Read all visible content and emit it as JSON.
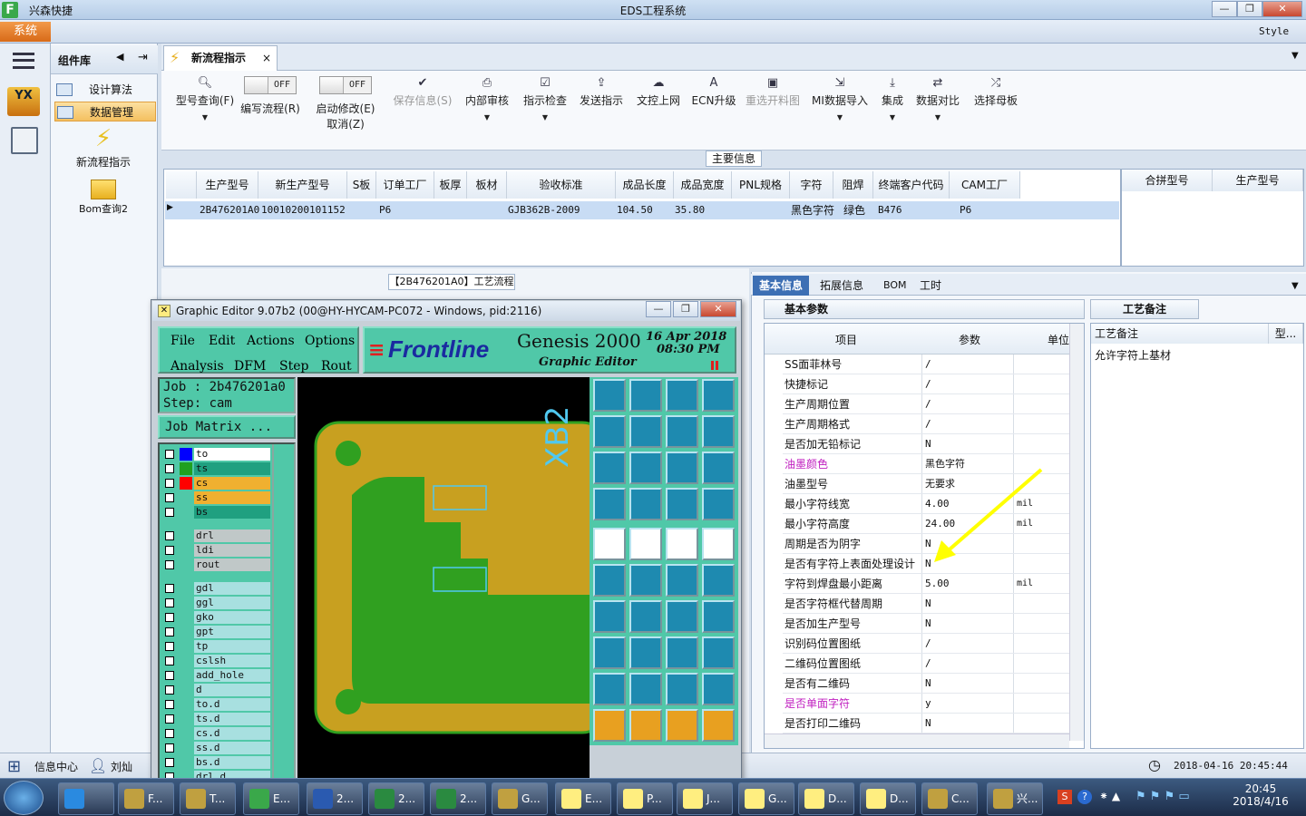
{
  "app": {
    "title": "EDS工程系统",
    "name": "兴森快捷",
    "system_tab": "系统",
    "style_label": "Style",
    "window_buttons": [
      "minimize-icon",
      "restore-icon",
      "close-icon"
    ]
  },
  "sidebar": {
    "header": "组件库",
    "items": [
      {
        "label": "设计算法",
        "icon": "table-icon"
      },
      {
        "label": "数据管理",
        "icon": "table-icon",
        "selected": true
      }
    ],
    "launchers": [
      {
        "label": "新流程指示",
        "icon": "lightning-icon"
      },
      {
        "label": "Bom查询2",
        "icon": "folder-icon"
      }
    ],
    "logo_text": "YX"
  },
  "main_tab": {
    "label": "新流程指示"
  },
  "toolbar": {
    "buttons": [
      {
        "label": "型号查询(F)",
        "icon": "search-icon"
      },
      {
        "label": "编写流程(R)",
        "toggle": "OFF"
      },
      {
        "label": "启动修改(E)",
        "sub": "取消(Z)",
        "toggle": "OFF"
      },
      {
        "label": "保存信息(S)",
        "icon": "check-icon",
        "disabled": true
      },
      {
        "label": "内部审核",
        "icon": "print-icon"
      },
      {
        "label": "指示检查",
        "icon": "checkbox-icon"
      },
      {
        "label": "发送指示",
        "icon": "upload-icon"
      },
      {
        "label": "文控上网",
        "icon": "cloud-icon"
      },
      {
        "label": "ECN升级",
        "icon": "letter-a-icon"
      },
      {
        "label": "重选开料图",
        "icon": "image-icon",
        "disabled": true
      },
      {
        "label": "MI数据导入",
        "icon": "import-icon"
      },
      {
        "label": "集成",
        "icon": "download-icon"
      },
      {
        "label": "数据对比",
        "icon": "compare-icon"
      },
      {
        "label": "选择母板",
        "icon": "shuffle-icon"
      }
    ]
  },
  "main_info": {
    "label": "主要信息",
    "columns": [
      "生产型号",
      "新生产型号",
      "S板",
      "订单工厂",
      "板厚",
      "板材",
      "验收标准",
      "成品长度",
      "成品宽度",
      "PNL规格",
      "字符",
      "阻焊",
      "终端客户代码",
      "CAM工厂"
    ],
    "row": [
      "2B476201A0",
      "10010200101152",
      "",
      "P6",
      "",
      "",
      "GJB362B-2009",
      "104.50",
      "35.80",
      "",
      "黑色字符",
      "绿色",
      "B476",
      "P6"
    ],
    "side_columns": [
      "合拼型号",
      "生产型号"
    ]
  },
  "process_label": "【2B476201A0】工艺流程",
  "detail_tabs": [
    "基本信息",
    "拓展信息",
    "BOM",
    "工时"
  ],
  "params": {
    "header": "基本参数",
    "columns": [
      "项目",
      "参数",
      "单位"
    ],
    "rows": [
      {
        "item": "SS面菲林号",
        "value": "/",
        "unit": ""
      },
      {
        "item": "快捷标记",
        "value": "/",
        "unit": ""
      },
      {
        "item": "生产周期位置",
        "value": "/",
        "unit": ""
      },
      {
        "item": "生产周期格式",
        "value": "/",
        "unit": ""
      },
      {
        "item": "是否加无铅标记",
        "value": "N",
        "unit": ""
      },
      {
        "item": "油墨颜色",
        "value": "黑色字符",
        "unit": "",
        "pink": true
      },
      {
        "item": "油墨型号",
        "value": "无要求",
        "unit": ""
      },
      {
        "item": "最小字符线宽",
        "value": "4.00",
        "unit": "mil"
      },
      {
        "item": "最小字符高度",
        "value": "24.00",
        "unit": "mil"
      },
      {
        "item": "周期是否为阴字",
        "value": "N",
        "unit": ""
      },
      {
        "item": "是否有字符上表面处理设计",
        "value": "N",
        "unit": ""
      },
      {
        "item": "字符到焊盘最小距离",
        "value": "5.00",
        "unit": "mil"
      },
      {
        "item": "是否字符框代替周期",
        "value": "N",
        "unit": ""
      },
      {
        "item": "是否加生产型号",
        "value": "N",
        "unit": ""
      },
      {
        "item": "识别码位置图纸",
        "value": "/",
        "unit": ""
      },
      {
        "item": "二维码位置图纸",
        "value": "/",
        "unit": ""
      },
      {
        "item": "是否有二维码",
        "value": "N",
        "unit": ""
      },
      {
        "item": "是否单面字符",
        "value": "y",
        "unit": "",
        "pink": true
      },
      {
        "item": "是否打印二维码",
        "value": "N",
        "unit": ""
      }
    ]
  },
  "notes": {
    "header": "工艺备注",
    "columns": [
      "工艺备注",
      "型..."
    ],
    "text": "允许字符上基材"
  },
  "status": {
    "info_center": "信息中心",
    "user": "刘灿",
    "datetime": "2018-04-16 20:45:44"
  },
  "genesis": {
    "title": "Graphic Editor 9.07b2 (00@HY-HYCAM-PC072 - Windows, pid:2116)",
    "menu": [
      "File",
      "Edit",
      "Actions",
      "Options",
      "Analysis",
      "DFM",
      "Step",
      "Rout"
    ],
    "brand": "Frontline",
    "product": "Genesis 2000",
    "subtitle": "Graphic Editor",
    "date": "16 Apr 2018",
    "time": "08:30 PM",
    "job": "Job : 2b476201a0",
    "step": "Step: cam",
    "job_matrix": "Job Matrix ...",
    "board_label": "XB2",
    "layers": [
      {
        "name": "to",
        "swatch": "#0000ff",
        "bg": "#ffffff"
      },
      {
        "name": "ts",
        "swatch": "#20a020",
        "bg": "#20a080"
      },
      {
        "name": "cs",
        "swatch": "#ff0000",
        "bg": "#f0b030"
      },
      {
        "name": "ss",
        "swatch": "#50c8a8",
        "bg": "#f0b030"
      },
      {
        "name": "bs",
        "swatch": "#50c8a8",
        "bg": "#20a080"
      },
      {
        "name": "drl",
        "swatch": "#50c8a8",
        "bg": "#c0c8c8"
      },
      {
        "name": "ldi",
        "swatch": "#50c8a8",
        "bg": "#c0c8c8"
      },
      {
        "name": "rout",
        "swatch": "#50c8a8",
        "bg": "#c0c8c8"
      },
      {
        "name": "gdl",
        "swatch": "#50c8a8",
        "bg": "#a8e0e0"
      },
      {
        "name": "ggl",
        "swatch": "#50c8a8",
        "bg": "#a8e0e0"
      },
      {
        "name": "gko",
        "swatch": "#50c8a8",
        "bg": "#a8e0e0"
      },
      {
        "name": "gpt",
        "swatch": "#50c8a8",
        "bg": "#a8e0e0"
      },
      {
        "name": "tp",
        "swatch": "#50c8a8",
        "bg": "#a8e0e0"
      },
      {
        "name": "cslsh",
        "swatch": "#50c8a8",
        "bg": "#a8e0e0"
      },
      {
        "name": "add_hole",
        "swatch": "#50c8a8",
        "bg": "#a8e0e0"
      },
      {
        "name": "d",
        "swatch": "#50c8a8",
        "bg": "#a8e0e0"
      },
      {
        "name": "to.d",
        "swatch": "#50c8a8",
        "bg": "#a8e0e0"
      },
      {
        "name": "ts.d",
        "swatch": "#50c8a8",
        "bg": "#a8e0e0"
      },
      {
        "name": "cs.d",
        "swatch": "#50c8a8",
        "bg": "#a8e0e0"
      },
      {
        "name": "ss.d",
        "swatch": "#50c8a8",
        "bg": "#a8e0e0"
      },
      {
        "name": "bs.d",
        "swatch": "#50c8a8",
        "bg": "#a8e0e0"
      },
      {
        "name": "drl.d",
        "swatch": "#50c8a8",
        "bg": "#a8e0e0"
      }
    ]
  },
  "taskbar": {
    "time": "20:45",
    "date": "2018/4/16",
    "items": [
      {
        "label": "",
        "icon": "ie-icon"
      },
      {
        "label": "F...",
        "icon": "app-icon"
      },
      {
        "label": "T...",
        "icon": "save-icon"
      },
      {
        "label": "E...",
        "icon": "eds-icon"
      },
      {
        "label": "2...",
        "icon": "word-icon"
      },
      {
        "label": "2...",
        "icon": "excel-icon"
      },
      {
        "label": "2...",
        "icon": "excel-icon"
      },
      {
        "label": "G...",
        "icon": "genesis-icon"
      },
      {
        "label": "E...",
        "icon": "x-icon"
      },
      {
        "label": "P...",
        "icon": "x-icon"
      },
      {
        "label": "J...",
        "icon": "x-icon"
      },
      {
        "label": "G...",
        "icon": "x-icon"
      },
      {
        "label": "D...",
        "icon": "x-icon"
      },
      {
        "label": "D...",
        "icon": "x-icon"
      },
      {
        "label": "C...",
        "icon": "cam-icon"
      },
      {
        "label": "兴...",
        "icon": "shell-icon"
      }
    ]
  },
  "colors": {
    "accent": "#3d6fb4",
    "system_tab": "#e87a28",
    "genesis_bg": "#50c8a8",
    "board_copper": "#c8a020",
    "board_green": "#30a020",
    "arrow": "#ffff00"
  }
}
